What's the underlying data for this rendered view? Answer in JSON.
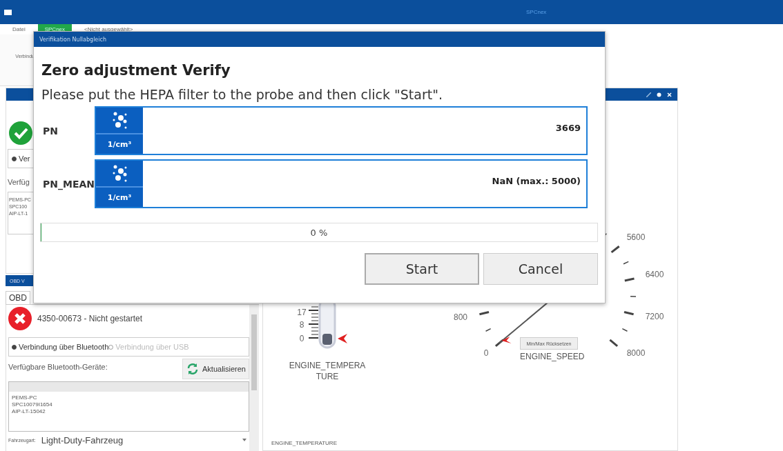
{
  "app": {
    "title": "SPCnex",
    "menu": [
      {
        "label": "Datei",
        "selected": false
      },
      {
        "label": "SPCnex",
        "selected": true
      },
      {
        "label": "<Nicht ausgewählt>",
        "selected": false
      }
    ],
    "ribbon_lines": [
      "Verbindu"
    ]
  },
  "device_panel": {
    "radio": {
      "label": "Ver",
      "selected": true
    },
    "devices_label": "Verfüg",
    "devices": [
      "PEMS-PC",
      "SPC100",
      "AIP-LT-1"
    ]
  },
  "obd_panel": {
    "header": "OBD V",
    "tab": "OBD",
    "status_text": "4350-00673 - Nicht gestartet",
    "connection_options": [
      {
        "label": "Verbindung über Bluetooth",
        "selected": true,
        "disabled": false
      },
      {
        "label": "Verbindung über USB",
        "selected": false,
        "disabled": true
      }
    ],
    "devices_label": "Verfügbare Bluetooth-Geräte:",
    "refresh_button": "Aktualisieren",
    "devices": [
      "PEMS-PC",
      "SPC10079I1654",
      "AIP-LT-15042"
    ],
    "vehicle_type_label": "Fahrzeugart:",
    "vehicle_type": "Light-Duty-Fahrzeug"
  },
  "gauges": {
    "thermometer": {
      "scale": [
        "17",
        "8",
        "0"
      ],
      "label": "ENGINE_TEMPERATURE"
    },
    "speed": {
      "scale": [
        "800",
        "0",
        "5600",
        "6400",
        "7200",
        "8000"
      ],
      "reset_button": "Min/Max Rücksetzen",
      "label": "ENGINE_SPEED"
    },
    "footer": "ENGINE_TEMPERATURE"
  },
  "dialog": {
    "title": "Verifikation Nullabgleich",
    "heading": "Zero adjustment Verify",
    "instruction": "Please put the HEPA filter to the probe and then click \"Start\".",
    "measurements": [
      {
        "label": "PN",
        "unit": "1/cm³",
        "value": "3669"
      },
      {
        "label": "PN_MEAN",
        "unit": "1/cm³",
        "value": "NaN (max.: 5000)"
      }
    ],
    "progress": {
      "level": 0,
      "text": "0 %"
    },
    "buttons": [
      "Start",
      "Cancel"
    ]
  }
}
